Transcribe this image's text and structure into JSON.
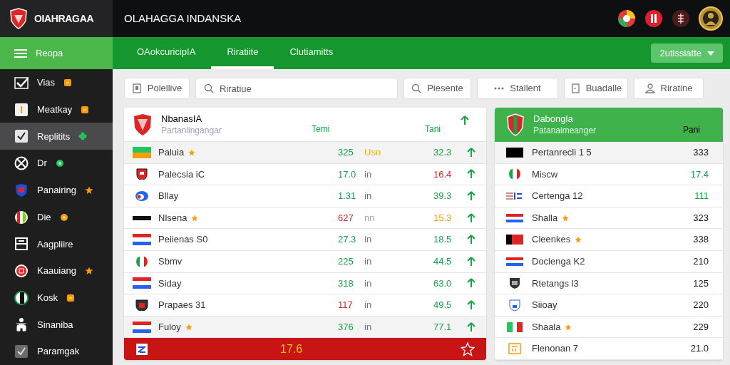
{
  "brand": {
    "name": "OIAHRAGAA"
  },
  "window": {
    "title": "OLAHAGGA INDANSKA"
  },
  "menu_button": {
    "label": "Reopa"
  },
  "sidebar": {
    "items": [
      {
        "label": "Vias",
        "selected": false,
        "badge": {
          "kind": "square",
          "color": "#f59e0b"
        }
      },
      {
        "label": "Meatkay",
        "selected": false,
        "badge": {
          "kind": "square",
          "color": "#f59e0b"
        }
      },
      {
        "label": "Replitits",
        "selected": true,
        "badge": {
          "kind": "flower",
          "color": "#22c55e"
        }
      },
      {
        "label": "Dr",
        "selected": false,
        "badge": {
          "kind": "circle",
          "color": "#22c55e"
        }
      },
      {
        "label": "Panairing",
        "selected": false,
        "badge": {
          "kind": "star",
          "color": "#f59e0b"
        }
      },
      {
        "label": "Die",
        "selected": false,
        "badge": {
          "kind": "circle",
          "color": "#f59e0b"
        }
      },
      {
        "label": "Aagpliire",
        "selected": false
      },
      {
        "label": "Kaauiang",
        "selected": false,
        "badge": {
          "kind": "star",
          "color": "#f59e0b"
        }
      },
      {
        "label": "Kosk",
        "selected": false,
        "badge": {
          "kind": "square",
          "color": "#f59e0b"
        }
      },
      {
        "label": "Sinaniba",
        "selected": false
      },
      {
        "label": "Paramgak",
        "selected": false
      }
    ]
  },
  "tabs": [
    {
      "label": "OAokcuricipIA",
      "selected": false
    },
    {
      "label": "Riratiite",
      "selected": true
    },
    {
      "label": "Clutiamitts",
      "selected": false
    }
  ],
  "dropdown": {
    "label": "2utissiatte"
  },
  "toolbar": [
    {
      "kind": "button",
      "label": "Polellive"
    },
    {
      "kind": "search",
      "placeholder": "Riratiue"
    },
    {
      "kind": "button",
      "label": "Piesente"
    },
    {
      "kind": "button",
      "label": "Stallent"
    },
    {
      "kind": "button",
      "label": "Buadalle"
    },
    {
      "kind": "button",
      "label": "Riratine"
    }
  ],
  "left_table": {
    "title": "NbanasIA",
    "subtitle": "Partanlingangar",
    "columns": [
      "Temi",
      "Tani"
    ],
    "rows": [
      {
        "name": "Paluia",
        "starred": true,
        "highlighted": true,
        "value": {
          "text": "325",
          "color": "#16a34a"
        },
        "unit": {
          "text": "Usn",
          "color": "#eab308"
        },
        "change": {
          "text": "32.3",
          "color": "#16a34a"
        }
      },
      {
        "name": "Palecsia iC",
        "starred": false,
        "highlighted": false,
        "value": {
          "text": "17.0",
          "color": "#16a34a"
        },
        "unit": {
          "text": "in",
          "color": "#6b7280"
        },
        "change": {
          "text": "16.4",
          "color": "#dc2626"
        }
      },
      {
        "name": "Bllay",
        "starred": false,
        "highlighted": false,
        "value": {
          "text": "1.31",
          "color": "#16a34a"
        },
        "unit": {
          "text": "in",
          "color": "#6b7280"
        },
        "change": {
          "text": "39.3",
          "color": "#16a34a"
        }
      },
      {
        "name": "Nlsena",
        "starred": true,
        "highlighted": false,
        "value": {
          "text": "627",
          "color": "#dc2626"
        },
        "unit": {
          "text": "nn",
          "color": "#9ca3af"
        },
        "change": {
          "text": "15.3",
          "color": "#f59e0b"
        }
      },
      {
        "name": "Peiienas S0",
        "starred": false,
        "highlighted": false,
        "value": {
          "text": "27.3",
          "color": "#16a34a"
        },
        "unit": {
          "text": "in",
          "color": "#6b7280"
        },
        "change": {
          "text": "18.5",
          "color": "#16a34a"
        }
      },
      {
        "name": "Sbmv",
        "starred": false,
        "highlighted": false,
        "value": {
          "text": "225",
          "color": "#16a34a"
        },
        "unit": {
          "text": "in",
          "color": "#6b7280"
        },
        "change": {
          "text": "44.5",
          "color": "#16a34a"
        }
      },
      {
        "name": "Siday",
        "starred": false,
        "highlighted": false,
        "value": {
          "text": "318",
          "color": "#16a34a"
        },
        "unit": {
          "text": "in",
          "color": "#6b7280"
        },
        "change": {
          "text": "63.0",
          "color": "#16a34a"
        }
      },
      {
        "name": "Prapaes 31",
        "starred": false,
        "highlighted": false,
        "value": {
          "text": "117",
          "color": "#dc2626"
        },
        "unit": {
          "text": "in",
          "color": "#6b7280"
        },
        "change": {
          "text": "49.5",
          "color": "#16a34a"
        }
      },
      {
        "name": "Fuloy",
        "starred": true,
        "highlighted": true,
        "value": {
          "text": "376",
          "color": "#16a34a"
        },
        "unit": {
          "text": "in",
          "color": "#6b7280"
        },
        "change": {
          "text": "77.1",
          "color": "#16a34a"
        }
      }
    ],
    "footer": {
      "value": "17.6"
    }
  },
  "right_table": {
    "title": "Dabongla",
    "subtitle": "Patanaimeanger",
    "column": "Pani",
    "rows": [
      {
        "name": "Pertanrecli 1 5",
        "starred": false,
        "highlighted": true,
        "value": {
          "text": "333",
          "color": "#111827"
        }
      },
      {
        "name": "Miscw",
        "starred": false,
        "highlighted": false,
        "value": {
          "text": "17.4",
          "color": "#16a34a"
        }
      },
      {
        "name": "Certenga 12",
        "starred": false,
        "highlighted": false,
        "value": {
          "text": "111",
          "color": "#16a34a"
        }
      },
      {
        "name": "Shalla",
        "starred": true,
        "highlighted": false,
        "value": {
          "text": "323",
          "color": "#111827"
        }
      },
      {
        "name": "Cleenkes",
        "starred": true,
        "highlighted": false,
        "value": {
          "text": "338",
          "color": "#111827"
        }
      },
      {
        "name": "Doclenga K2",
        "starred": false,
        "highlighted": false,
        "value": {
          "text": "210",
          "color": "#111827"
        }
      },
      {
        "name": "Rtetangs l3",
        "starred": false,
        "highlighted": false,
        "value": {
          "text": "125",
          "color": "#111827"
        }
      },
      {
        "name": "Siioay",
        "starred": false,
        "highlighted": false,
        "value": {
          "text": "220",
          "color": "#111827"
        }
      },
      {
        "name": "Shaala",
        "starred": true,
        "highlighted": false,
        "value": {
          "text": "229",
          "color": "#111827"
        }
      },
      {
        "name": "Flenonan 7",
        "starred": false,
        "highlighted": false,
        "value": {
          "text": "21.0",
          "color": "#111827"
        }
      }
    ]
  }
}
